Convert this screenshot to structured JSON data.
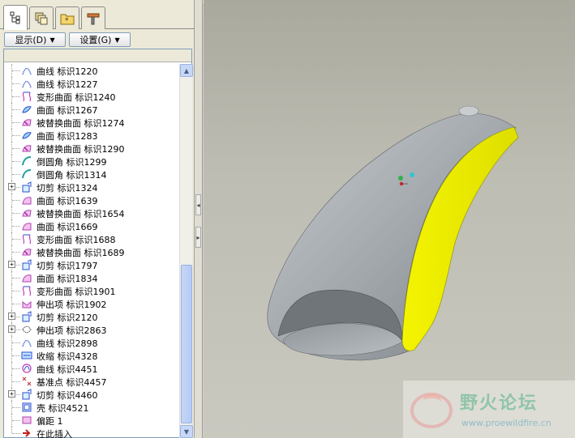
{
  "tabs": [
    {
      "icon": "model-tree-icon",
      "active": true
    },
    {
      "icon": "layers-icon",
      "active": false
    },
    {
      "icon": "folder-star-icon",
      "active": false
    },
    {
      "icon": "tool-icon",
      "active": false
    }
  ],
  "menus": {
    "display_label": "显示(D)",
    "settings_label": "设置(G)"
  },
  "tree": {
    "items": [
      {
        "label": "曲线 标识1220",
        "icon": "curve-icon",
        "expandable": false
      },
      {
        "label": "曲线 标识1227",
        "icon": "curve-icon",
        "expandable": false
      },
      {
        "label": "变形曲面 标识1240",
        "icon": "warp-surface-icon",
        "expandable": false
      },
      {
        "label": "曲面 标识1267",
        "icon": "surface-icon",
        "expandable": false
      },
      {
        "label": "被替换曲面 标识1274",
        "icon": "replace-surface-icon",
        "expandable": false
      },
      {
        "label": "曲面 标识1283",
        "icon": "surface-icon",
        "expandable": false
      },
      {
        "label": "被替换曲面 标识1290",
        "icon": "replace-surface-icon",
        "expandable": false
      },
      {
        "label": "倒圆角 标识1299",
        "icon": "round-icon",
        "expandable": false
      },
      {
        "label": "倒圆角 标识1314",
        "icon": "round-icon",
        "expandable": false
      },
      {
        "label": "切剪 标识1324",
        "icon": "cut-icon",
        "expandable": true
      },
      {
        "label": "曲面 标识1639",
        "icon": "surface-pink-icon",
        "expandable": false
      },
      {
        "label": "被替换曲面 标识1654",
        "icon": "replace-surface-icon",
        "expandable": false
      },
      {
        "label": "曲面 标识1669",
        "icon": "surface-pink-icon",
        "expandable": false
      },
      {
        "label": "变形曲面 标识1688",
        "icon": "warp-surface-icon",
        "expandable": false
      },
      {
        "label": "被替换曲面 标识1689",
        "icon": "replace-surface-icon",
        "expandable": false
      },
      {
        "label": "切剪 标识1797",
        "icon": "cut-icon",
        "expandable": true
      },
      {
        "label": "曲面 标识1834",
        "icon": "surface-pink-icon",
        "expandable": false
      },
      {
        "label": "变形曲面 标识1901",
        "icon": "warp-surface-icon",
        "expandable": false
      },
      {
        "label": "伸出项 标识1902",
        "icon": "protrusion-icon",
        "expandable": false
      },
      {
        "label": "切剪 标识2120",
        "icon": "cut-icon",
        "expandable": true
      },
      {
        "label": "伸出项 标识2863",
        "icon": "protrusion-blend-icon",
        "expandable": true
      },
      {
        "label": "曲线 标识2898",
        "icon": "curve-icon",
        "expandable": false
      },
      {
        "label": "收缩 标识4328",
        "icon": "shrink-icon",
        "expandable": false
      },
      {
        "label": "曲线 标识4451",
        "icon": "curve-pink-icon",
        "expandable": false
      },
      {
        "label": "基准点 标识4457",
        "icon": "datum-point-icon",
        "expandable": false
      },
      {
        "label": "切剪 标识4460",
        "icon": "cut-icon",
        "expandable": true
      },
      {
        "label": "壳 标识4521",
        "icon": "shell-icon",
        "expandable": false
      },
      {
        "label": "偏距 1",
        "icon": "offset-icon",
        "expandable": false
      },
      {
        "label": "在此插入",
        "icon": "insert-here-icon",
        "expandable": false
      }
    ]
  },
  "colors": {
    "model_body": "#a4a9ae",
    "model_cut_face": "#f2f200",
    "viewport_bg": "#bdbdb3"
  },
  "watermark": {
    "title": "野火论坛",
    "url": "www.proewildfire.cn"
  }
}
